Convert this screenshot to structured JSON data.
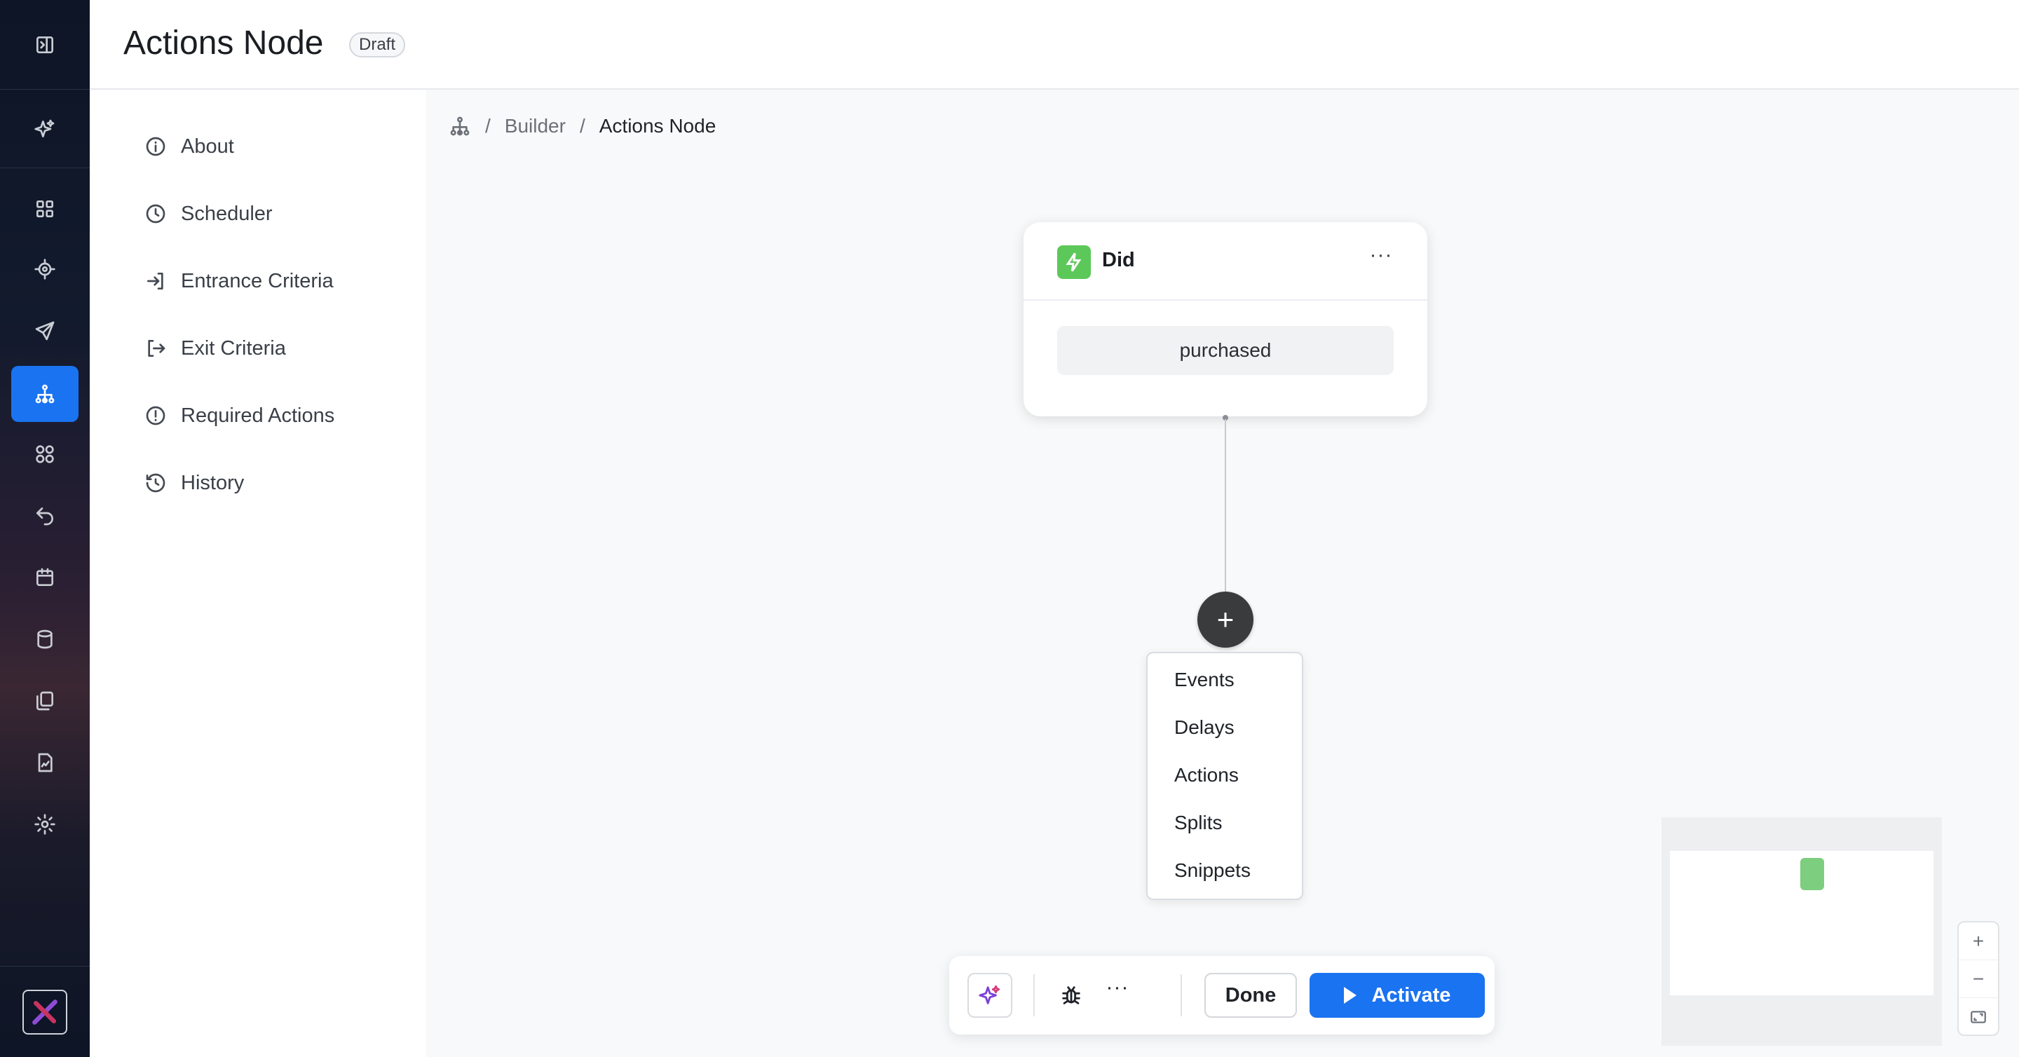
{
  "header": {
    "title": "Actions Node",
    "status_badge": "Draft"
  },
  "rail": {
    "items": [
      "collapse-icon",
      "sparkles-icon",
      "dashboard-icon",
      "target-icon",
      "send-icon",
      "journey-icon",
      "segments-icon",
      "undo-icon",
      "calendar-icon",
      "database-icon",
      "templates-icon",
      "reports-icon",
      "gear-icon",
      "brand-logo"
    ],
    "active": "journey-icon",
    "accent": "#1a73f0"
  },
  "settings_nav": {
    "items": [
      {
        "label": "About",
        "icon": "info-icon"
      },
      {
        "label": "Scheduler",
        "icon": "clock-icon"
      },
      {
        "label": "Entrance Criteria",
        "icon": "enter-icon"
      },
      {
        "label": "Exit Criteria",
        "icon": "exit-icon"
      },
      {
        "label": "Required Actions",
        "icon": "alert-icon"
      },
      {
        "label": "History",
        "icon": "history-icon"
      }
    ]
  },
  "canvas": {
    "breadcrumb": {
      "icon": "journey-icon",
      "separator": "/",
      "parent": "Builder",
      "current": "Actions Node"
    },
    "node": {
      "title": "Did",
      "more": "···",
      "value": "purchased",
      "icon_color": "#5dc85a"
    },
    "add_button": "+",
    "add_menu": [
      "Events",
      "Delays",
      "Actions",
      "Splits",
      "Snippets"
    ]
  },
  "toolbar": {
    "more": "···",
    "done_label": "Done",
    "activate_label": "Activate"
  },
  "zoom_controls": {
    "zoom_in": "+",
    "zoom_out": "−",
    "fit": "⛶"
  }
}
